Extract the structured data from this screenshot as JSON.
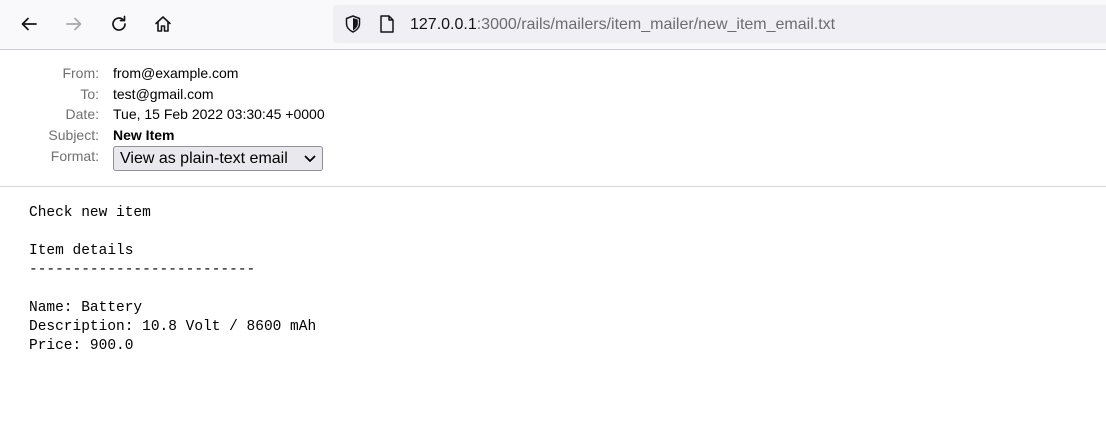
{
  "browser": {
    "url_host": "127.0.0.1",
    "url_rest": ":3000/rails/mailers/item_mailer/new_item_email.txt"
  },
  "email": {
    "from_label": "From:",
    "from_value": "from@example.com",
    "to_label": "To:",
    "to_value": "test@gmail.com",
    "date_label": "Date:",
    "date_value": "Tue, 15 Feb 2022 03:30:45 +0000",
    "subject_label": "Subject:",
    "subject_value": "New Item",
    "format_label": "Format:",
    "format_selected": "View as plain-text email"
  },
  "body": {
    "lines": [
      "Check new item",
      "",
      "Item details",
      "--------------------------",
      "",
      "Name: Battery",
      "Description: 10.8 Volt / 8600 mAh",
      "Price: 900.0"
    ]
  },
  "icons": {
    "back": "back-arrow-icon",
    "forward": "forward-arrow-icon",
    "reload": "reload-icon",
    "home": "home-icon",
    "shield": "shield-icon",
    "page": "page-icon",
    "chevron": "chevron-down-icon"
  }
}
